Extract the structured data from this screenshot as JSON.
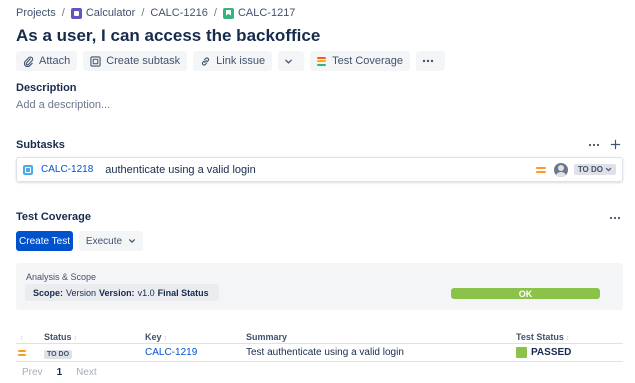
{
  "breadcrumb": {
    "items": [
      "Projects",
      "Calculator",
      "CALC-1216",
      "CALC-1217"
    ],
    "separator": "/"
  },
  "issue": {
    "title": "As a user, I can access the backoffice"
  },
  "toolbar": {
    "attach": "Attach",
    "create_subtask": "Create subtask",
    "link_issue": "Link issue",
    "test_coverage": "Test Coverage"
  },
  "description": {
    "heading": "Description",
    "placeholder": "Add a description..."
  },
  "subtasks": {
    "heading": "Subtasks",
    "items": [
      {
        "key": "CALC-1218",
        "summary": "authenticate using a valid login",
        "status": "TO DO"
      }
    ]
  },
  "test_coverage": {
    "heading": "Test Coverage",
    "create_test": "Create Test",
    "execute": "Execute",
    "analysis_label": "Analysis & Scope",
    "scope_label": "Scope:",
    "scope_value": "Version",
    "version_label": "Version:",
    "version_value": "v1.0",
    "final_status_label": "Final Status",
    "ok_status": "OK",
    "ok_color": "#8bc34a",
    "table": {
      "columns": [
        "Status",
        "Key",
        "Summary",
        "Test Status"
      ],
      "rows": [
        {
          "status": "TO DO",
          "key": "CALC-1219",
          "summary": "Test authenticate using a valid login",
          "test_status": "PASSED"
        }
      ]
    }
  },
  "pagination": {
    "prev": "Prev",
    "current": "1",
    "next": "Next"
  },
  "colors": {
    "primary": "#0052cc",
    "priority_medium": "#ff991f",
    "passed": "#8bc34a"
  }
}
